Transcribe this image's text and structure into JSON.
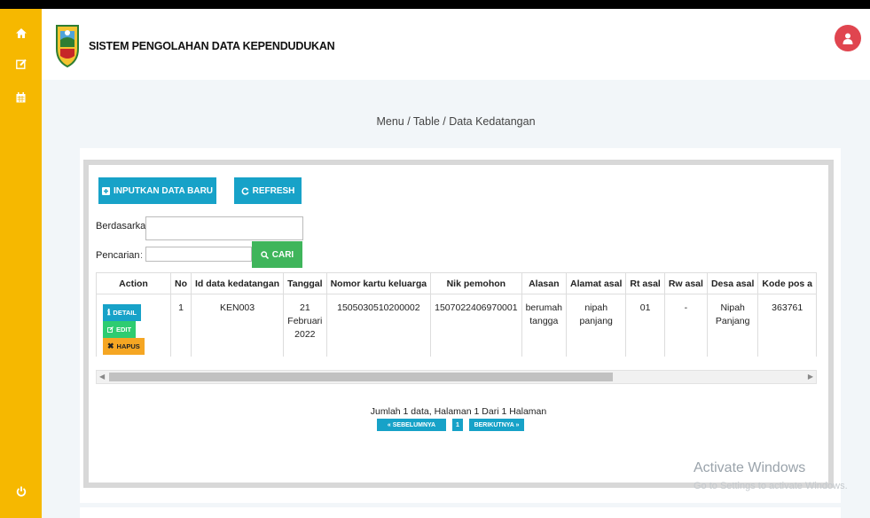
{
  "app": {
    "title": "SISTEM PENGOLAHAN DATA KEPENDUDUKAN"
  },
  "breadcrumb": "Menu / Table / Data Kedatangan",
  "toolbar": {
    "new_label": "INPUTKAN DATA BARU",
    "refresh_label": "REFRESH"
  },
  "search": {
    "filter_label": "Berdasarkan:",
    "filter_value": "",
    "query_label": "Pencarian",
    "query_value": "",
    "button_label": "CARI"
  },
  "table": {
    "headers": [
      "Action",
      "No",
      "Id data kedatangan",
      "Tanggal",
      "Nomor kartu keluarga",
      "Nik pemohon",
      "Alasan",
      "Alamat asal",
      "Rt asal",
      "Rw asal",
      "Desa asal",
      "Kode pos a"
    ],
    "action_labels": {
      "detail": "DETAIL",
      "edit": "EDIT",
      "hapus": "HAPUS"
    },
    "rows": [
      {
        "no": "1",
        "id": "KEN003",
        "tanggal": "21 Februari 2022",
        "nkk": "1505030510200002",
        "nik": "1507022406970001",
        "alasan": "berumah tangga",
        "alamat": "nipah panjang",
        "rt": "01",
        "rw": "-",
        "desa": "Nipah Panjang",
        "kodepos": "363761"
      }
    ]
  },
  "pagination": {
    "info": "Jumlah 1 data, Halaman 1 Dari 1 Halaman",
    "prev_label": "« SEBELUMNYA",
    "page": "1",
    "next_label": "BERIKUTNYA »"
  },
  "watermark": {
    "line1": "Activate Windows",
    "line2": "Go to Settings to activate Windows."
  },
  "colors": {
    "sidebar": "#f6b800",
    "primary": "#17a2c8",
    "success": "#3fb55b",
    "danger": "#e0454f",
    "warning": "#f5a623"
  },
  "icons": {
    "sidebar": [
      "home-icon",
      "edit-icon",
      "calendar-icon",
      "power-icon"
    ],
    "user": "user-icon"
  }
}
